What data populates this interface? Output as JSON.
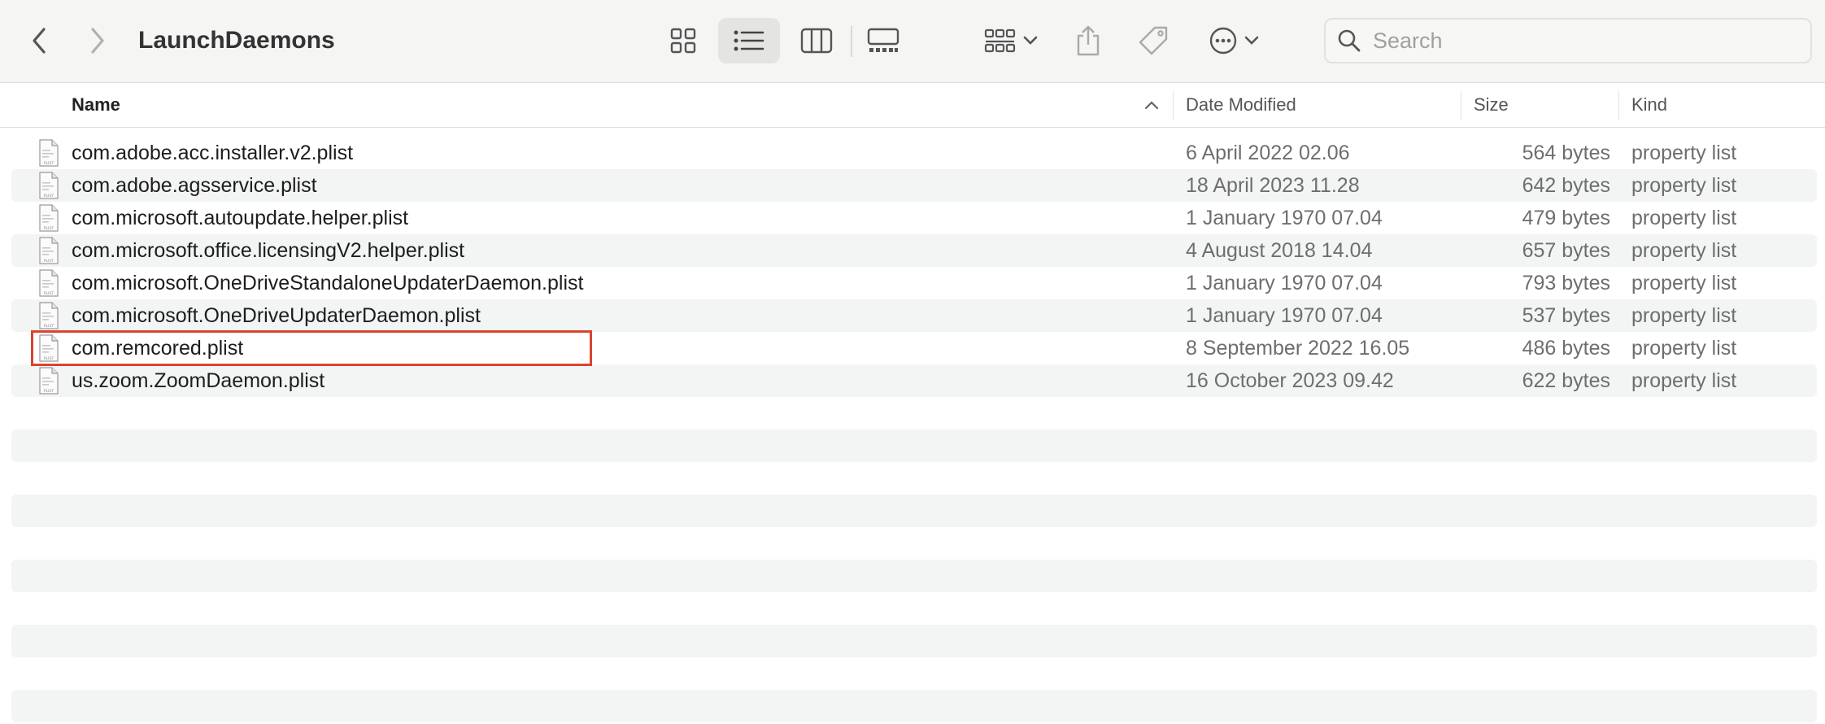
{
  "window": {
    "title": "LaunchDaemons"
  },
  "toolbar": {
    "back_icon": "chevron-left-icon",
    "forward_icon": "chevron-right-icon",
    "view_modes": [
      "icon-view",
      "list-view",
      "column-view",
      "gallery-view"
    ],
    "active_view": "list-view",
    "group_icon": "group-by-icon",
    "share_icon": "share-icon",
    "tag_icon": "tag-icon",
    "more_icon": "ellipsis-circle-icon"
  },
  "search": {
    "placeholder": "Search"
  },
  "columns": {
    "name": "Name",
    "date": "Date Modified",
    "size": "Size",
    "kind": "Kind"
  },
  "files": [
    {
      "name": "com.adobe.acc.installer.v2.plist",
      "date": "6 April 2022 02.06",
      "size": "564 bytes",
      "kind": "property list"
    },
    {
      "name": "com.adobe.agsservice.plist",
      "date": "18 April 2023 11.28",
      "size": "642 bytes",
      "kind": "property list"
    },
    {
      "name": "com.microsoft.autoupdate.helper.plist",
      "date": "1 January 1970 07.04",
      "size": "479 bytes",
      "kind": "property list"
    },
    {
      "name": "com.microsoft.office.licensingV2.helper.plist",
      "date": "4 August 2018 14.04",
      "size": "657 bytes",
      "kind": "property list"
    },
    {
      "name": "com.microsoft.OneDriveStandaloneUpdaterDaemon.plist",
      "date": "1 January 1970 07.04",
      "size": "793 bytes",
      "kind": "property list"
    },
    {
      "name": "com.microsoft.OneDriveUpdaterDaemon.plist",
      "date": "1 January 1970 07.04",
      "size": "537 bytes",
      "kind": "property list"
    },
    {
      "name": "com.remcored.plist",
      "date": "8 September 2022 16.05",
      "size": "486 bytes",
      "kind": "property list"
    },
    {
      "name": "us.zoom.ZoomDaemon.plist",
      "date": "16 October 2023 09.42",
      "size": "622 bytes",
      "kind": "property list"
    }
  ],
  "colors": {
    "highlight": "#d94430",
    "alt_row": "#f3f4f4",
    "toolbar": "#f5f5f4"
  }
}
